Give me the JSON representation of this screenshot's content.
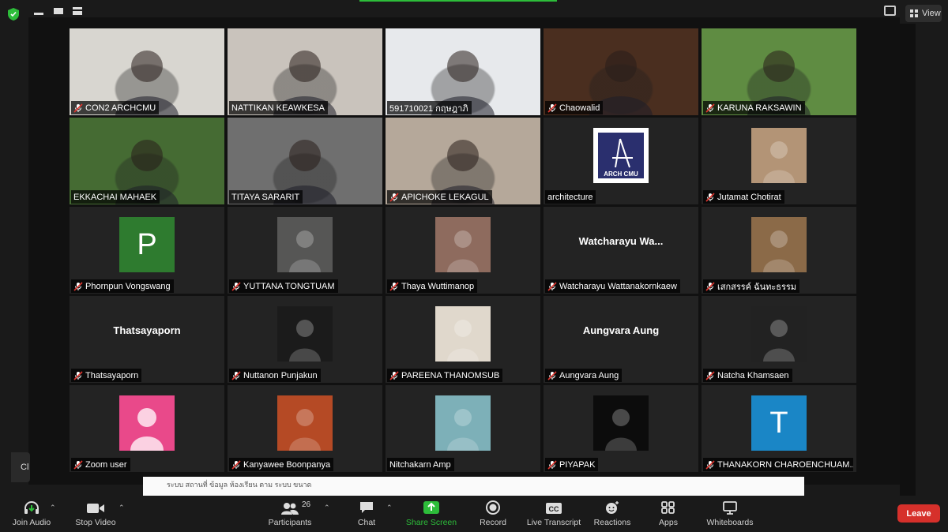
{
  "window": {
    "view_label": "View",
    "stub_label": "Cl"
  },
  "shared_doc_snippet": "ระบบ สถานที่ ข้อมูล ห้องเรียน ตาม ระบบ ขนาด",
  "participants": [
    {
      "name": "CON2 ARCHCMU",
      "muted": true,
      "video": true,
      "bg": "#d8d6d0"
    },
    {
      "name": "NATTIKAN KEAWKESA",
      "muted": false,
      "video": true,
      "bg": "#c9c3bc"
    },
    {
      "name": "591710021 กฤษฎาภิ",
      "muted": false,
      "video": true,
      "bg": "#e7e9ec"
    },
    {
      "name": "Chaowalid",
      "muted": true,
      "video": true,
      "bg": "#4a2e1f"
    },
    {
      "name": "KARUNA RAKSAWIN",
      "muted": true,
      "video": true,
      "bg": "#5f8c42"
    },
    {
      "name": "EKKACHAI MAHAEK",
      "muted": false,
      "video": true,
      "bg": "#456b33",
      "active": true
    },
    {
      "name": "TITAYA SARARIT",
      "muted": false,
      "video": true,
      "bg": "#6f6f6f"
    },
    {
      "name": "APICHOKE LEKAGUL",
      "muted": true,
      "video": true,
      "bg": "#b5a89a"
    },
    {
      "name": "architecture",
      "muted": false,
      "avatar_logo": "ARCH CMU"
    },
    {
      "name": "Jutamat Chotirat",
      "muted": true,
      "avatar_photo": true,
      "bg": "#b39476"
    },
    {
      "name": "Phornpun Vongswang",
      "muted": true,
      "avatar_letter": "P",
      "avatar_color": "#2e7b2f"
    },
    {
      "name": "YUTTANA TONGTUAM",
      "muted": true,
      "avatar_photo": true,
      "bg": "#565655"
    },
    {
      "name": "Thaya Wuttimanop",
      "muted": true,
      "avatar_photo": true,
      "bg": "#8e6b5e"
    },
    {
      "name": "Watcharayu Wattanakornkaew",
      "muted": true,
      "display_name": "Watcharayu  Wa..."
    },
    {
      "name": "เสกสรรค์ ฉันทะธรรม",
      "muted": true,
      "avatar_photo": true,
      "bg": "#8b6a48"
    },
    {
      "name": "Thatsayaporn",
      "muted": true,
      "display_name": "Thatsayaporn"
    },
    {
      "name": "Nuttanon Punjakun",
      "muted": true,
      "avatar_photo": true,
      "bg": "#1b1b1b"
    },
    {
      "name": "PAREENA THANOMSUB",
      "muted": true,
      "avatar_photo": true,
      "bg": "#e0d8cc"
    },
    {
      "name": "Aungvara Aung",
      "muted": true,
      "display_name": "Aungvara Aung"
    },
    {
      "name": "Natcha Khamsaen",
      "muted": true,
      "avatar_photo": true,
      "bg": "#222222"
    },
    {
      "name": "Zoom user",
      "muted": true,
      "avatar_default": true,
      "avatar_color": "#e9498a"
    },
    {
      "name": "Kanyawee Boonpanya",
      "muted": true,
      "avatar_photo": true,
      "bg": "#b54a25"
    },
    {
      "name": "Nitchakarn Amp",
      "muted": false,
      "avatar_photo": true,
      "bg": "#7db0b8"
    },
    {
      "name": "PIYAPAK",
      "muted": true,
      "avatar_photo": true,
      "bg": "#0c0c0c"
    },
    {
      "name": "THANAKORN CHAROENCHUAM...",
      "muted": true,
      "avatar_letter": "T",
      "avatar_color": "#1a86c6"
    }
  ],
  "toolbar": {
    "join_audio": "Join Audio",
    "stop_video": "Stop Video",
    "participants": "Participants",
    "participant_count": "26",
    "chat": "Chat",
    "share_screen": "Share Screen",
    "record": "Record",
    "live_transcript": "Live Transcript",
    "reactions": "Reactions",
    "apps": "Apps",
    "whiteboards": "Whiteboards",
    "leave": "Leave"
  },
  "colors": {
    "share_green": "#2dbd3a",
    "leave_red": "#d6302b",
    "active_speaker": "#d7df5c"
  }
}
